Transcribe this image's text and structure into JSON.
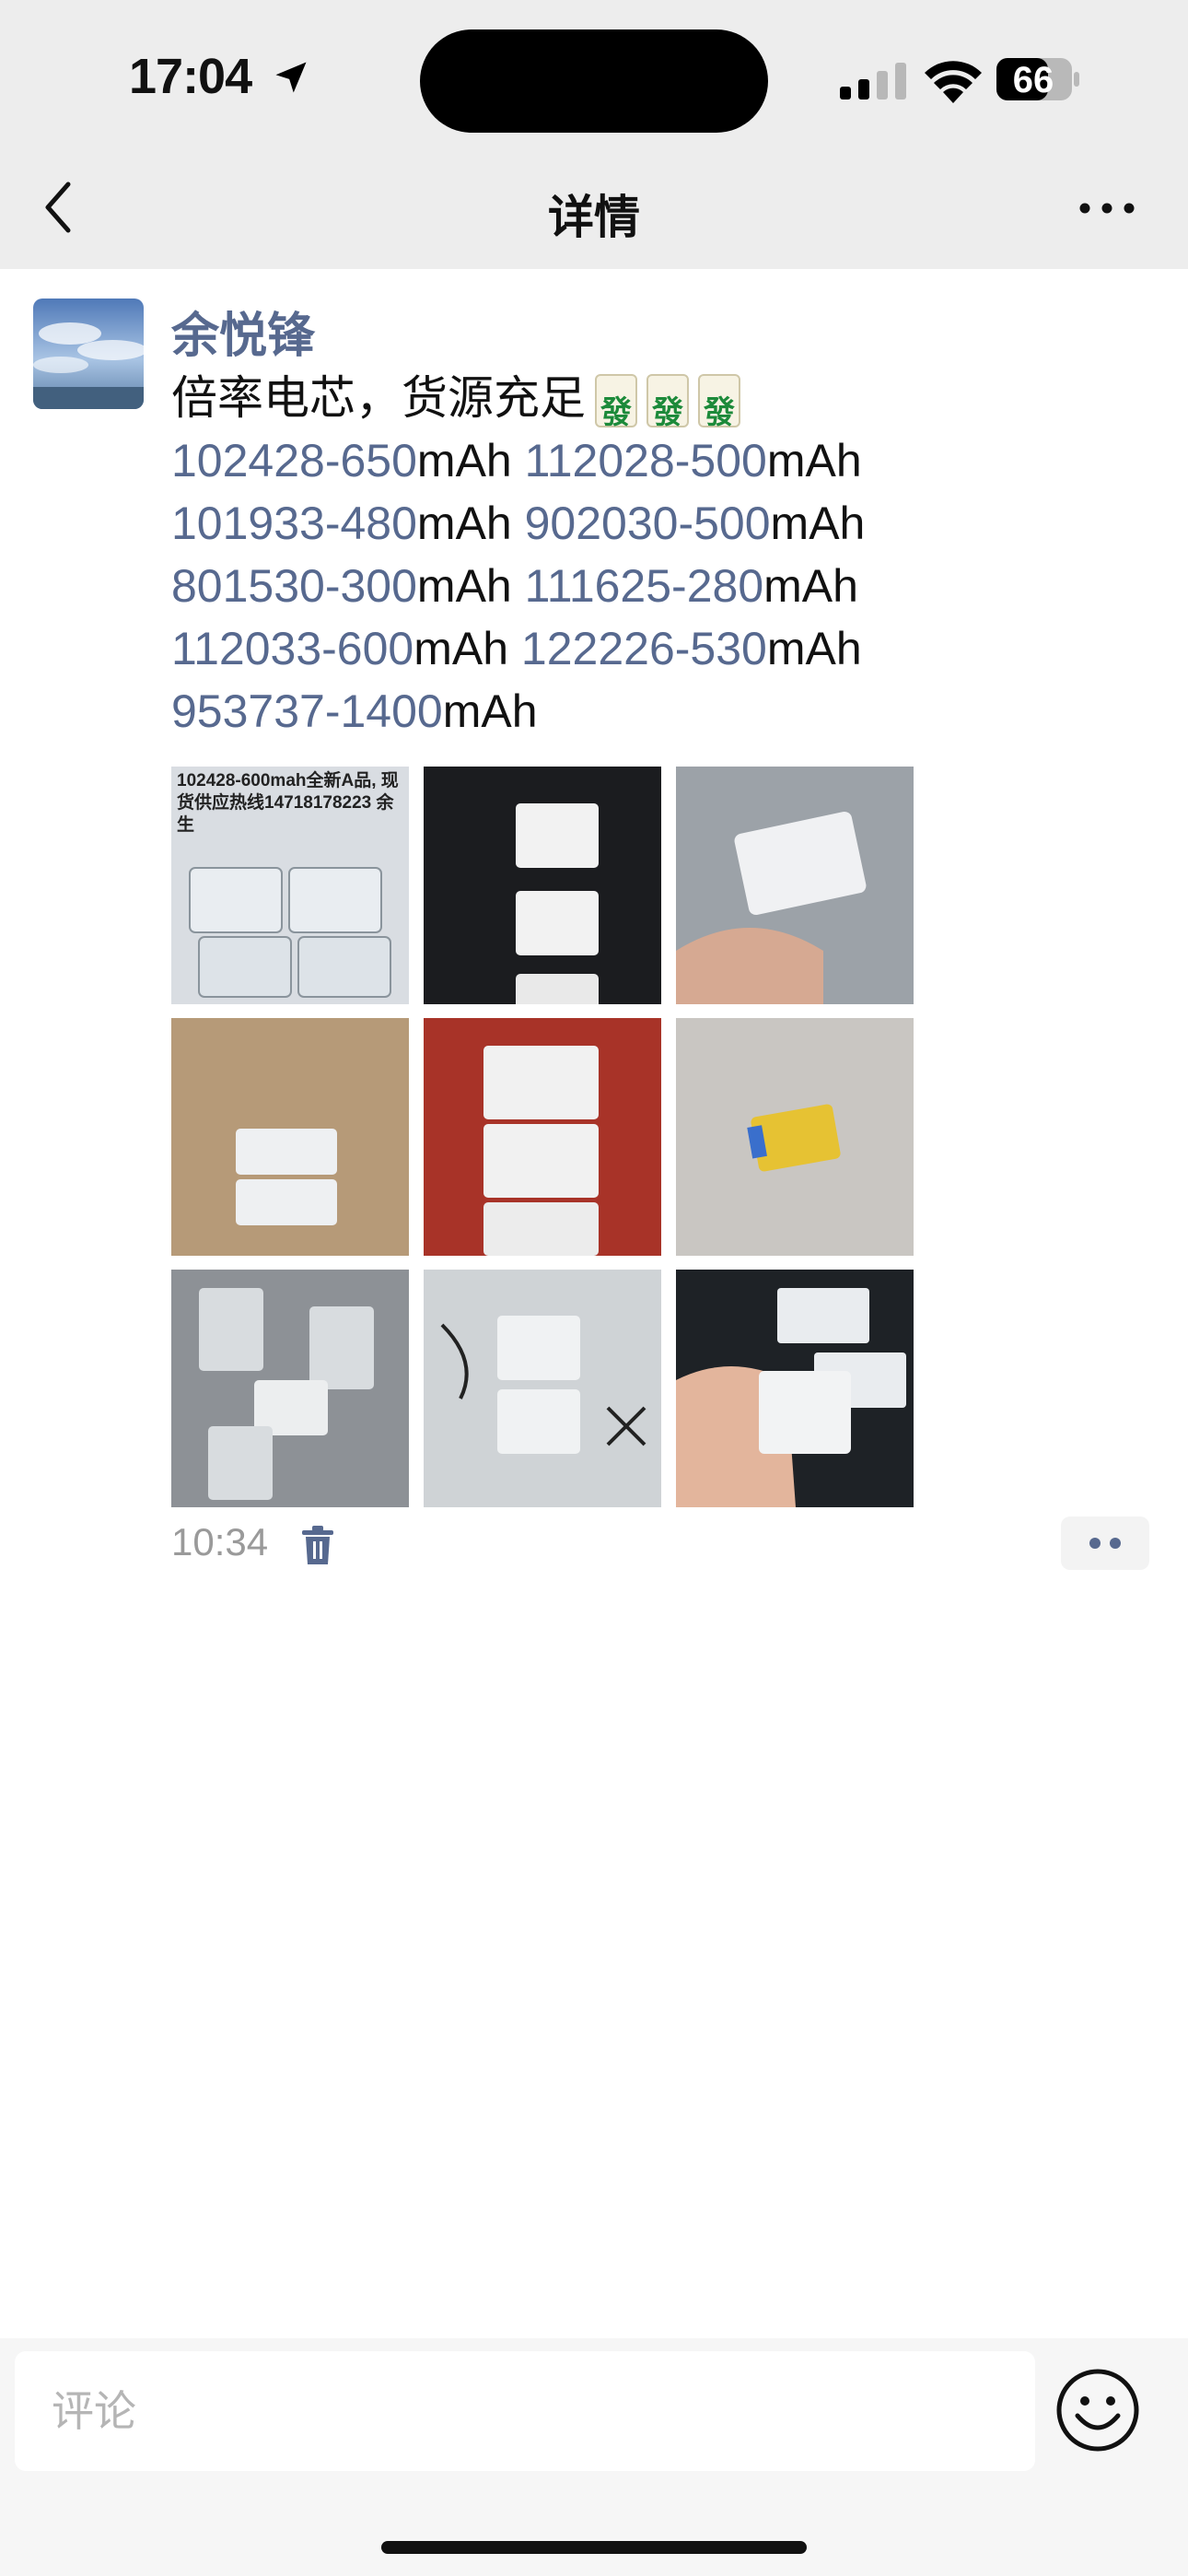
{
  "status_bar": {
    "time": "17:04",
    "battery": "66"
  },
  "nav": {
    "title": "详情",
    "back_icon": "chevron-left-icon",
    "more_icon": "ellipsis-icon"
  },
  "post": {
    "author": "余悦锋",
    "lines": [
      {
        "segments": [
          {
            "text": "倍率电芯，货源充足",
            "style": "plain"
          }
        ],
        "emojis": [
          "發",
          "發",
          "發"
        ]
      },
      {
        "segments": [
          {
            "text": "102428-650",
            "style": "link"
          },
          {
            "text": "mAh ",
            "style": "plain"
          },
          {
            "text": "112028-500",
            "style": "link"
          },
          {
            "text": "mAh",
            "style": "plain"
          }
        ]
      },
      {
        "segments": [
          {
            "text": "101933-480",
            "style": "link"
          },
          {
            "text": "mAh ",
            "style": "plain"
          },
          {
            "text": "902030-500",
            "style": "link"
          },
          {
            "text": "mAh",
            "style": "plain"
          }
        ]
      },
      {
        "segments": [
          {
            "text": "801530-300",
            "style": "link"
          },
          {
            "text": "mAh ",
            "style": "plain"
          },
          {
            "text": "111625-280",
            "style": "link"
          },
          {
            "text": "mAh",
            "style": "plain"
          }
        ]
      },
      {
        "segments": [
          {
            "text": "112033-600",
            "style": "link"
          },
          {
            "text": "mAh ",
            "style": "plain"
          },
          {
            "text": "122226-530",
            "style": "link"
          },
          {
            "text": "mAh",
            "style": "plain"
          }
        ]
      },
      {
        "segments": [
          {
            "text": "953737-1400",
            "style": "link"
          },
          {
            "text": "mAh",
            "style": "plain"
          }
        ]
      }
    ],
    "photo_caption": "102428-600mah全新A品, 现货供应热线14718178223 余生",
    "photos": [
      {
        "name": "photo-batteries-grid",
        "bg": "#d9dde2"
      },
      {
        "name": "photo-batteries-tray",
        "bg": "#1b1c1f"
      },
      {
        "name": "photo-battery-in-hand",
        "bg": "#9ca2a8"
      },
      {
        "name": "photo-batteries-on-cardboard",
        "bg": "#b69a78"
      },
      {
        "name": "photo-batteries-on-red-table",
        "bg": "#a83328"
      },
      {
        "name": "photo-yellow-battery",
        "bg": "#c9c6c2"
      },
      {
        "name": "photo-batteries-in-tray",
        "bg": "#8d9196"
      },
      {
        "name": "photo-batteries-pile",
        "bg": "#cfd3d6"
      },
      {
        "name": "photo-battery-held",
        "bg": "#1e2226"
      }
    ],
    "time": "10:34"
  },
  "comment": {
    "placeholder": "评论"
  },
  "colors": {
    "link": "#57698f",
    "nav_bg": "#ededed",
    "timestamp": "#9a9a9a"
  }
}
